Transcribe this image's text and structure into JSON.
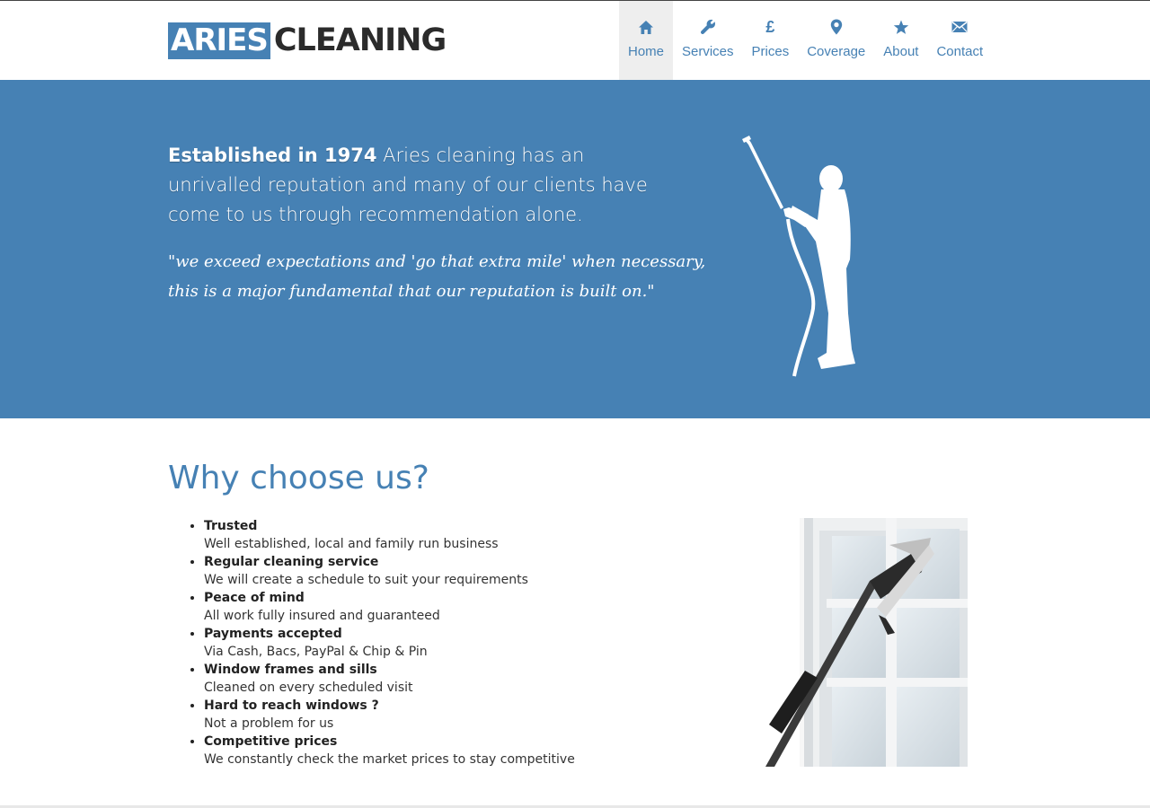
{
  "logo": {
    "boxed": "ARIES",
    "word": "CLEANING"
  },
  "nav": {
    "items": [
      {
        "label": "Home",
        "icon": "home-icon"
      },
      {
        "label": "Services",
        "icon": "wrench-icon"
      },
      {
        "label": "Prices",
        "icon": "pound-icon"
      },
      {
        "label": "Coverage",
        "icon": "map-pin-icon"
      },
      {
        "label": "About",
        "icon": "star-icon"
      },
      {
        "label": "Contact",
        "icon": "envelope-icon"
      }
    ],
    "pound_glyph": "£",
    "active": "Home"
  },
  "hero": {
    "lead_bold": "Established in 1974",
    "lead_rest": " Aries cleaning has an unrivalled reputation and many of our clients have come to us through recommendation alone.",
    "quote": "\"we exceed expectations and 'go that extra mile' when necessary, this is a major fundamental that our reputation is built on.\""
  },
  "why": {
    "title": "Why choose us?",
    "features": [
      {
        "title": "Trusted",
        "desc": "Well established, local and family run business"
      },
      {
        "title": "Regular cleaning service",
        "desc": "We will create a schedule to suit your requirements"
      },
      {
        "title": "Peace of mind",
        "desc": "All work fully insured and guaranteed"
      },
      {
        "title": "Payments accepted",
        "desc": "Via Cash, Bacs, PayPal & Chip & Pin"
      },
      {
        "title": "Window frames and sills",
        "desc": "Cleaned on every scheduled visit"
      },
      {
        "title": "Hard to reach windows ?",
        "desc": "Not a problem for us"
      },
      {
        "title": "Competitive prices",
        "desc": "We constantly check the market prices to stay competitive"
      }
    ]
  },
  "colors": {
    "brand": "#4681b4",
    "nav_active_bg": "#eeeeee",
    "text": "#333333"
  }
}
